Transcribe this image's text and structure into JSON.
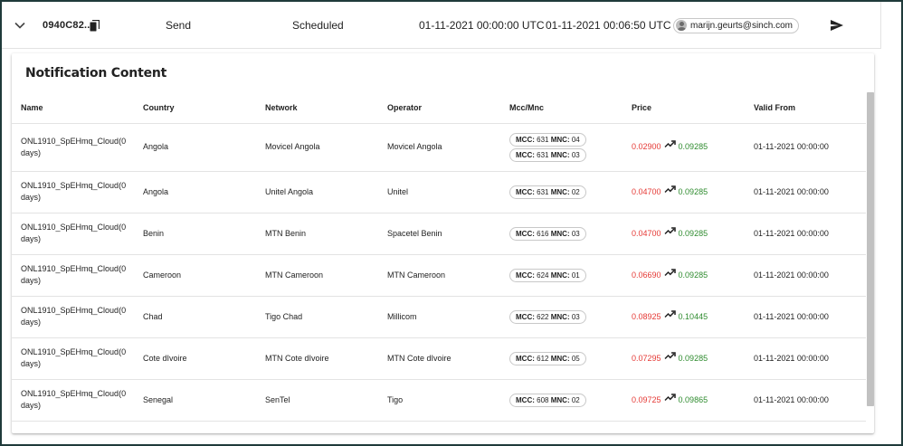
{
  "summary": {
    "message_id": "0940C82...",
    "type": "Send",
    "status": "Scheduled",
    "start_time": "01-11-2021 00:00:00 UTC",
    "end_time": "01-11-2021 00:06:50 UTC",
    "user_email": "marijn.geurts@sinch.com"
  },
  "panel": {
    "title": "Notification Content",
    "columns": [
      "Name",
      "Country",
      "Network",
      "Operator",
      "Mcc/Mnc",
      "Price",
      "Valid From"
    ],
    "rows": [
      {
        "name": "ONL1910_SpEHmq_Cloud(0 days)",
        "country": "Angola",
        "network": "Movicel Angola",
        "operator": "Movicel Angola",
        "mcc_mnc": [
          {
            "mcc_label": "MCC:",
            "mcc": "631",
            "mnc_label": "MNC:",
            "mnc": "04"
          },
          {
            "mcc_label": "MCC:",
            "mcc": "631",
            "mnc_label": "MNC:",
            "mnc": "03"
          }
        ],
        "price_old": "0.02900",
        "price_new": "0.09285",
        "valid_from": "01-11-2021 00:00:00"
      },
      {
        "name": "ONL1910_SpEHmq_Cloud(0 days)",
        "country": "Angola",
        "network": "Unitel Angola",
        "operator": "Unitel",
        "mcc_mnc": [
          {
            "mcc_label": "MCC:",
            "mcc": "631",
            "mnc_label": "MNC:",
            "mnc": "02"
          }
        ],
        "price_old": "0.04700",
        "price_new": "0.09285",
        "valid_from": "01-11-2021 00:00:00"
      },
      {
        "name": "ONL1910_SpEHmq_Cloud(0 days)",
        "country": "Benin",
        "network": "MTN Benin",
        "operator": "Spacetel Benin",
        "mcc_mnc": [
          {
            "mcc_label": "MCC:",
            "mcc": "616",
            "mnc_label": "MNC:",
            "mnc": "03"
          }
        ],
        "price_old": "0.04700",
        "price_new": "0.09285",
        "valid_from": "01-11-2021 00:00:00"
      },
      {
        "name": "ONL1910_SpEHmq_Cloud(0 days)",
        "country": "Cameroon",
        "network": "MTN Cameroon",
        "operator": "MTN Cameroon",
        "mcc_mnc": [
          {
            "mcc_label": "MCC:",
            "mcc": "624",
            "mnc_label": "MNC:",
            "mnc": "01"
          }
        ],
        "price_old": "0.06690",
        "price_new": "0.09285",
        "valid_from": "01-11-2021 00:00:00"
      },
      {
        "name": "ONL1910_SpEHmq_Cloud(0 days)",
        "country": "Chad",
        "network": "Tigo Chad",
        "operator": "Millicom",
        "mcc_mnc": [
          {
            "mcc_label": "MCC:",
            "mcc": "622",
            "mnc_label": "MNC:",
            "mnc": "03"
          }
        ],
        "price_old": "0.08925",
        "price_new": "0.10445",
        "valid_from": "01-11-2021 00:00:00"
      },
      {
        "name": "ONL1910_SpEHmq_Cloud(0 days)",
        "country": "Cote dIvoire",
        "network": "MTN Cote dIvoire",
        "operator": "MTN Cote dIvoire",
        "mcc_mnc": [
          {
            "mcc_label": "MCC:",
            "mcc": "612",
            "mnc_label": "MNC:",
            "mnc": "05"
          }
        ],
        "price_old": "0.07295",
        "price_new": "0.09285",
        "valid_from": "01-11-2021 00:00:00"
      },
      {
        "name": "ONL1910_SpEHmq_Cloud(0 days)",
        "country": "Senegal",
        "network": "SenTel",
        "operator": "Tigo",
        "mcc_mnc": [
          {
            "mcc_label": "MCC:",
            "mcc": "608",
            "mnc_label": "MNC:",
            "mnc": "02"
          }
        ],
        "price_old": "0.09725",
        "price_new": "0.09865",
        "valid_from": "01-11-2021 00:00:00"
      }
    ]
  },
  "icons": {
    "expand": "chevron-down-icon",
    "copy": "copy-icon",
    "user": "account-circle-icon",
    "send": "send-icon",
    "trend": "trending-up-icon"
  },
  "colors": {
    "price_old": "#e53935",
    "price_new": "#2e8b2e",
    "frame_border": "#1f3a3a"
  }
}
